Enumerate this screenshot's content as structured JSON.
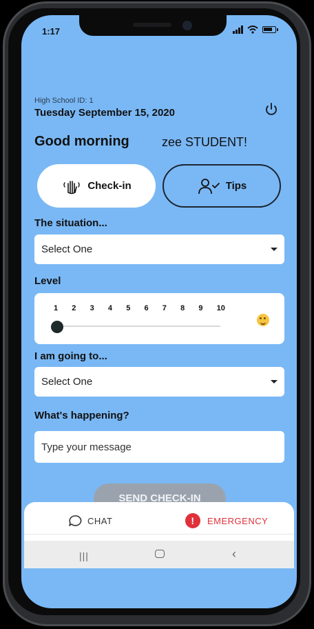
{
  "status_bar": {
    "time": "1:17"
  },
  "header": {
    "school_id": "High School ID: 1",
    "date": "Tuesday September 15, 2020",
    "greeting": "Good morning",
    "name": "zee STUDENT!"
  },
  "toggles": {
    "checkin_label": "Check-in",
    "tips_label": "Tips"
  },
  "form": {
    "situation_label": "The situation...",
    "situation_value": "Select One",
    "level_label": "Level",
    "level_ticks": [
      "1",
      "2",
      "3",
      "4",
      "5",
      "6",
      "7",
      "8",
      "9",
      "10"
    ],
    "level_value": 1,
    "going_label": "I am going to...",
    "going_value": "Select One",
    "happening_label": "What's happening?",
    "message_placeholder": "Type your message",
    "send_label": "SEND CHECK-IN"
  },
  "bottom_nav": {
    "chat_label": "CHAT",
    "emergency_label": "EMERGENCY",
    "emergency_badge": "!"
  },
  "colors": {
    "screen_bg": "#7ab8f5",
    "emergency": "#e0303a",
    "send_disabled": "#9aa3ad"
  }
}
